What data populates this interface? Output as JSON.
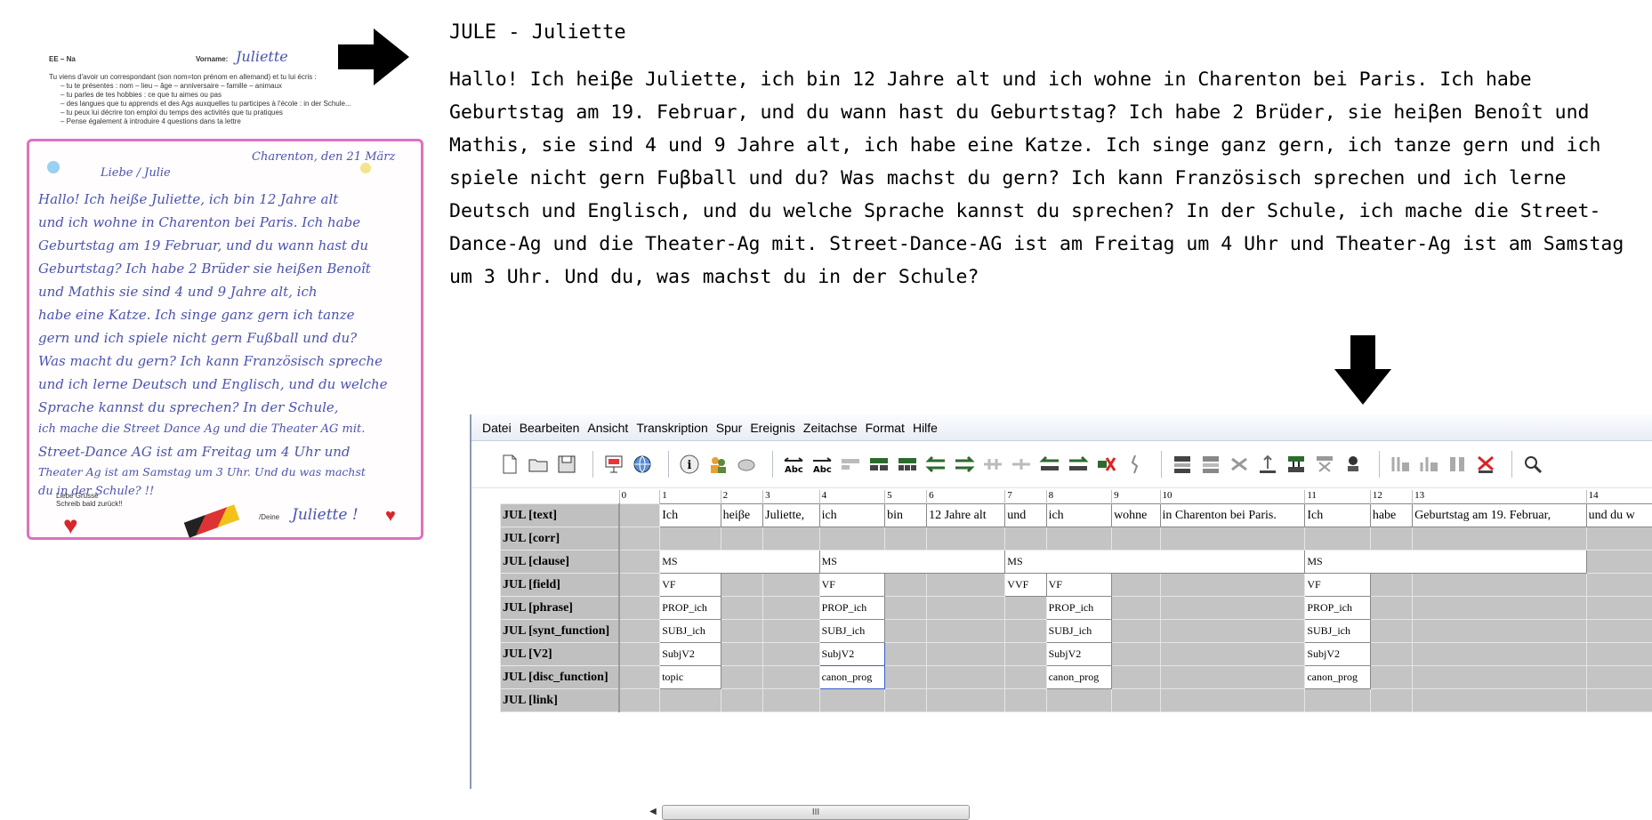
{
  "letter": {
    "ee_label": "EE – Na",
    "vorname_label": "Vorname:",
    "vorname_value": "Juliette",
    "instructions": [
      "Tu viens d'avoir un correspondant (son nom=ton prénom en allemand) et tu lui écris :",
      "–  tu te présentes : nom – lieu – âge – anniversaire – famille – animaux",
      "–  tu parles de tes hobbies : ce que tu aimes ou pas",
      "–  des langues que tu apprends et des Ags auxquelles tu participes à l'école : in der Schule...",
      "–  tu peux lui décrire ton emploi du temps des activités que tu pratiques",
      "–  Pense également à introduire 4 questions dans ta lettre"
    ],
    "date_line": "Charenton, den 21 März",
    "salutation": "Liebe / Julie",
    "handwriting": [
      "Hallo! Ich heiße Juliette, ich bin 12 Jahre alt",
      "und ich wohne in Charenton bei Paris. Ich habe",
      "Geburtstag am 19 Februar, und du wann hast du",
      "Geburtstag? Ich habe 2 Brüder sie heißen Benoît",
      "und Mathis sie sind 4 und 9 Jahre alt, ich",
      "habe eine Katze. Ich singe ganz gern ich tanze",
      "gern und ich spiele nicht gern Fußball und du?",
      "Was macht du gern? Ich kann Französisch spreche",
      "und ich lerne Deutsch und Englisch, und du welche",
      "Sprache kannst du sprechen? In der Schule,",
      "ich mache die Street Dance Ag und die Theater AG mit.",
      "Street-Dance AG ist am Freitag um 4 Uhr und",
      "Theater Ag ist am Samstag um 3 Uhr. Und du was machst",
      "du in der Schule? !!"
    ],
    "closing_printed": "Liebe Grüsse\nSchreib bald zurück!!",
    "deine": "/Deine",
    "signature": "Juliette !"
  },
  "transcription": {
    "title": "JULE - Juliette",
    "body": "Hallo! Ich heiβe Juliette, ich bin 12 Jahre alt und ich wohne in Charenton bei Paris. Ich habe Geburtstag am 19. Februar, und du wann hast du Geburtstag? Ich habe 2 Brüder, sie heiβen Benoît und Mathis, sie sind 4 und 9 Jahre alt, ich habe eine Katze. Ich singe ganz gern, ich tanze gern und ich spiele nicht gern Fuβball und du? Was machst du gern? Ich kann Französisch sprechen und ich lerne Deutsch und Englisch, und du welche Sprache kannst du sprechen? In der Schule, ich mache die Street-Dance-Ag und die Theater-Ag mit. Street-Dance-AG ist am Freitag um 4 Uhr und Theater-Ag ist am Samstag um 3 Uhr. Und du, was machst du in der Schule?"
  },
  "app": {
    "menu": [
      "Datei",
      "Bearbeiten",
      "Ansicht",
      "Transkription",
      "Spur",
      "Ereignis",
      "Zeitachse",
      "Format",
      "Hilfe"
    ],
    "scroll_grip": "III",
    "columns": [
      "0",
      "1",
      "2",
      "3",
      "4",
      "5",
      "6",
      "7",
      "8",
      "9",
      "10",
      "11",
      "12",
      "13",
      "14"
    ],
    "tiers": [
      "JUL [text]",
      "JUL [corr]",
      "JUL [clause]",
      "JUL [field]",
      "JUL [phrase]",
      "JUL [synt_function]",
      "JUL [V2]",
      "JUL [disc_function]",
      "JUL [link]"
    ],
    "text_row": [
      "Ich",
      "heiβe",
      "Juliette,",
      "ich",
      "bin",
      "12 Jahre alt",
      "und",
      "ich",
      "wohne",
      "in Charenton bei Paris.",
      "Ich",
      "habe",
      "Geburtstag am 19. Februar,",
      "und du w"
    ],
    "clause": [
      "MS",
      "MS",
      "MS",
      "MS"
    ],
    "field": [
      "VF",
      "VF",
      "VVF",
      "VF",
      "VF"
    ],
    "phrase": [
      "PROP_ich",
      "PROP_ich",
      "PROP_ich",
      "PROP_ich"
    ],
    "synt": [
      "SUBJ_ich",
      "SUBJ_ich",
      "SUBJ_ich",
      "SUBJ_ich"
    ],
    "v2": [
      "SubjV2",
      "SubjV2",
      "SubjV2",
      "SubjV2"
    ],
    "disc": [
      "topic",
      "canon_prog",
      "canon_prog",
      "canon_prog"
    ]
  }
}
